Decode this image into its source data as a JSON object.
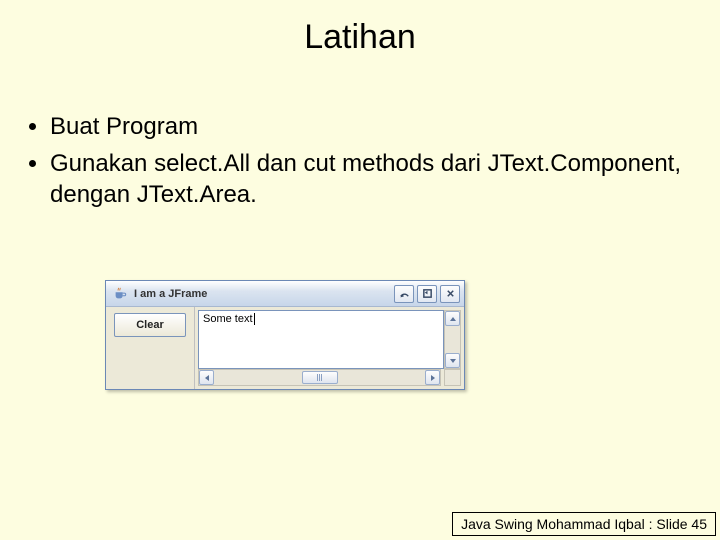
{
  "title": "Latihan",
  "bullets": [
    "Buat Program",
    "Gunakan select.All dan cut methods dari JText.Component, dengan JText.Area."
  ],
  "jframe": {
    "title": "I am a JFrame",
    "clear_button": "Clear",
    "textarea_value": "Some text"
  },
  "footer": "Java Swing Mohammad Iqbal : Slide 45"
}
